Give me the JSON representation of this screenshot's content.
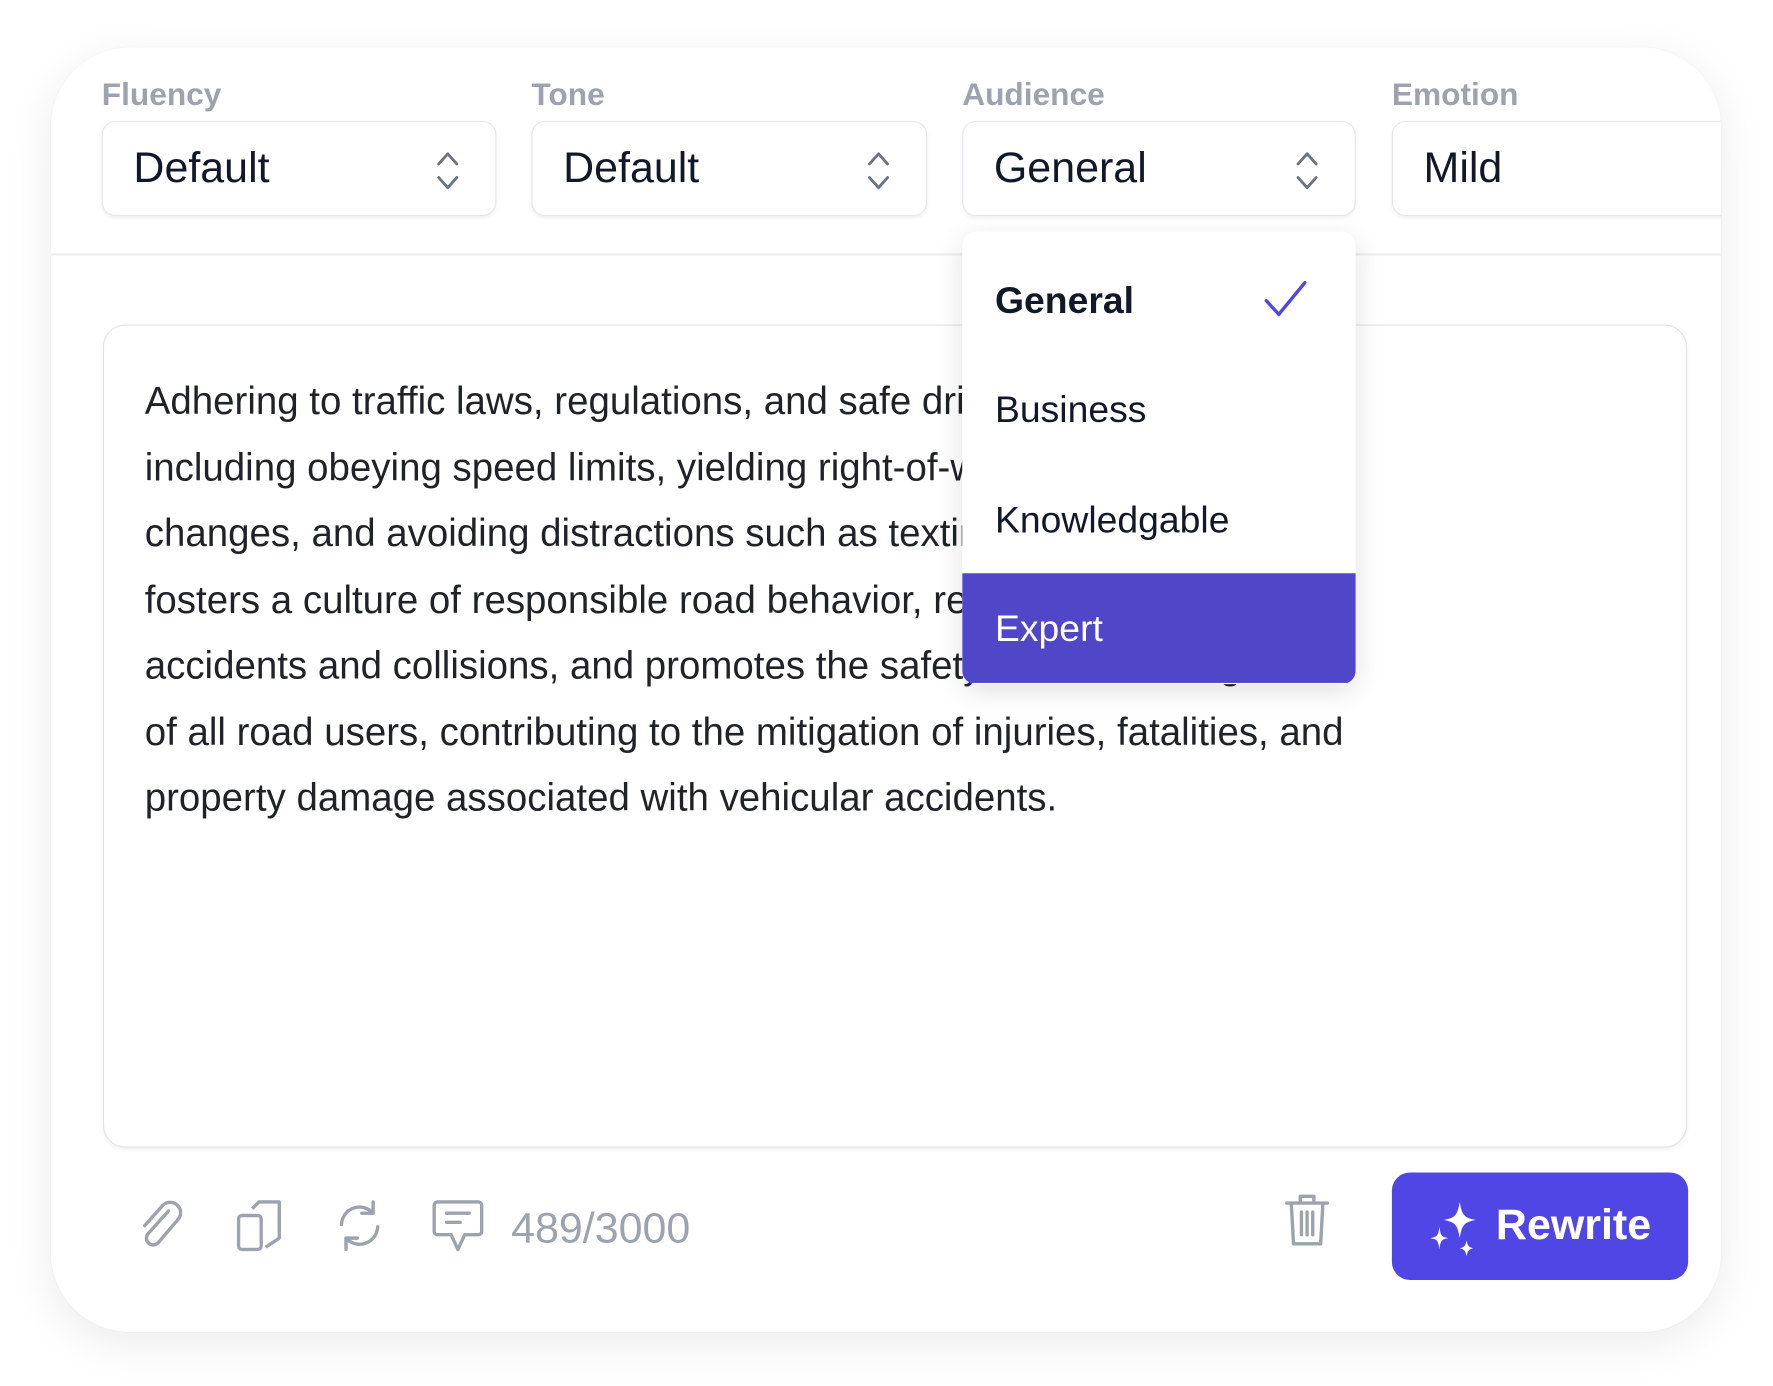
{
  "fields": [
    {
      "label": "Fluency",
      "value": "Default"
    },
    {
      "label": "Tone",
      "value": "Default"
    },
    {
      "label": "Audience",
      "value": "General"
    },
    {
      "label": "Emotion",
      "value": "Mild"
    }
  ],
  "audience_dropdown": {
    "options": [
      "General",
      "Business",
      "Knowledgable",
      "Expert"
    ],
    "selected": "General",
    "highlighted": "Expert"
  },
  "editor": {
    "lines": [
      "Adhering to traffic laws, regulations, and safe driving practices,",
      "including obeying speed limits, yielding right-of-way, signaling lane",
      "changes, and avoiding distractions such as texting or impaired driving,",
      "fosters a culture of responsible road behavior, reduces the likelihood of",
      "accidents and collisions, and promotes the safety and well-being",
      "of all road users, contributing to the mitigation of injuries, fatalities, and",
      "property damage associated with vehicular accidents."
    ]
  },
  "toolbar": {
    "icons": [
      "paperclip-icon",
      "copy-icon",
      "refresh-icon",
      "feedback-icon",
      "trash-icon",
      "sparkles-icon"
    ],
    "char_count": "489/3000",
    "rewrite_label": "Rewrite"
  },
  "colors": {
    "accent": "#4f46e5",
    "highlight": "#4f46c8",
    "label": "#9ca3af"
  }
}
